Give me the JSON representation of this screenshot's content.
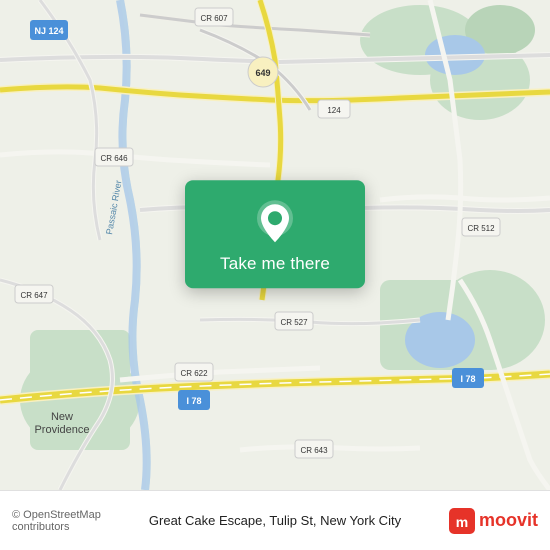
{
  "map": {
    "alt": "Map of New York City area showing Great Cake Escape location"
  },
  "overlay": {
    "button_label": "Take me there",
    "pin_icon": "location-pin-icon"
  },
  "bottom_bar": {
    "copyright": "© OpenStreetMap contributors",
    "location_label": "Great Cake Escape, Tulip St, New York City",
    "moovit_label": "moovit"
  }
}
